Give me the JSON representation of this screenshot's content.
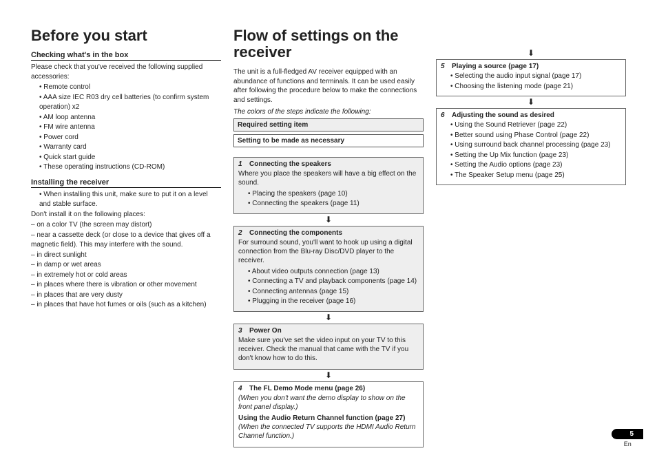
{
  "col1": {
    "h1": "Before you start",
    "sec1": {
      "title": "Checking what's in the box",
      "intro": "Please check that you've received the following supplied accessories:",
      "items": [
        "Remote control",
        "AAA size IEC R03 dry cell batteries (to confirm system operation) x2",
        "AM loop antenna",
        "FM wire antenna",
        "Power cord",
        "Warranty card",
        "Quick start guide",
        "These operating instructions (CD-ROM)"
      ]
    },
    "sec2": {
      "title": "Installing the receiver",
      "bullet1": "When installing this unit, make sure to put it on a level and stable surface.",
      "intro2": "Don't install it on the following places:",
      "places": [
        "– on a color TV (the screen may distort)",
        "– near a cassette deck (or close to a device that gives off a magnetic field). This may interfere with the sound.",
        "– in direct sunlight",
        "– in damp or wet areas",
        "– in extremely hot or cold areas",
        "– in places where there is vibration or other movement",
        "– in places that are very dusty",
        "– in places that have hot fumes or oils (such as a kitchen)"
      ]
    }
  },
  "col2": {
    "h1": "Flow of settings on the receiver",
    "intro": "The unit is a full-fledged AV receiver equipped with an abundance of functions and terminals. It can be used easily after following the procedure below to make the connections and settings.",
    "legend_intro": "The colors of the steps indicate the following:",
    "legend_req": "Required setting item",
    "legend_opt": "Setting to be made as necessary",
    "step1": {
      "num": "1",
      "title": "Connecting the speakers",
      "body": "Where you place the speakers will have a big effect on the sound.",
      "items": [
        "Placing the speakers (page 10)",
        "Connecting the speakers (page 11)"
      ]
    },
    "step2": {
      "num": "2",
      "title": "Connecting the components",
      "body": "For surround sound, you'll want to hook up using a digital connection from the Blu-ray Disc/DVD player to the receiver.",
      "items": [
        "About video outputs connection (page 13)",
        "Connecting a TV and playback components (page 14)",
        "Connecting antennas (page 15)",
        "Plugging in the receiver (page 16)"
      ]
    },
    "step3": {
      "num": "3",
      "title": "Power On",
      "body": "Make sure you've set the video input on your TV to this receiver. Check the manual that came with the TV if you don't know how to do this."
    },
    "step4": {
      "num": "4",
      "title": "The FL Demo Mode menu (page 26)",
      "note1": "(When you don't want the demo display to show on the front panel display.)",
      "sub": "Using the Audio Return Channel function (page 27)",
      "note2": "(When the connected TV supports the HDMI Audio Return Channel function.)"
    }
  },
  "col3": {
    "step5": {
      "num": "5",
      "title": "Playing a source (page 17)",
      "items": [
        "Selecting the audio input signal (page 17)",
        "Choosing the listening mode (page 21)"
      ]
    },
    "step6": {
      "num": "6",
      "title": "Adjusting the sound as desired",
      "items": [
        "Using the Sound Retriever (page 22)",
        "Better sound using Phase Control (page 22)",
        "Using surround back channel processing (page 23)",
        "Setting the Up Mix function (page 23)",
        "Setting the Audio options (page 23)",
        "The Speaker Setup menu (page 25)"
      ]
    }
  },
  "page": {
    "num": "5",
    "lang": "En"
  },
  "arrow": "⬇"
}
